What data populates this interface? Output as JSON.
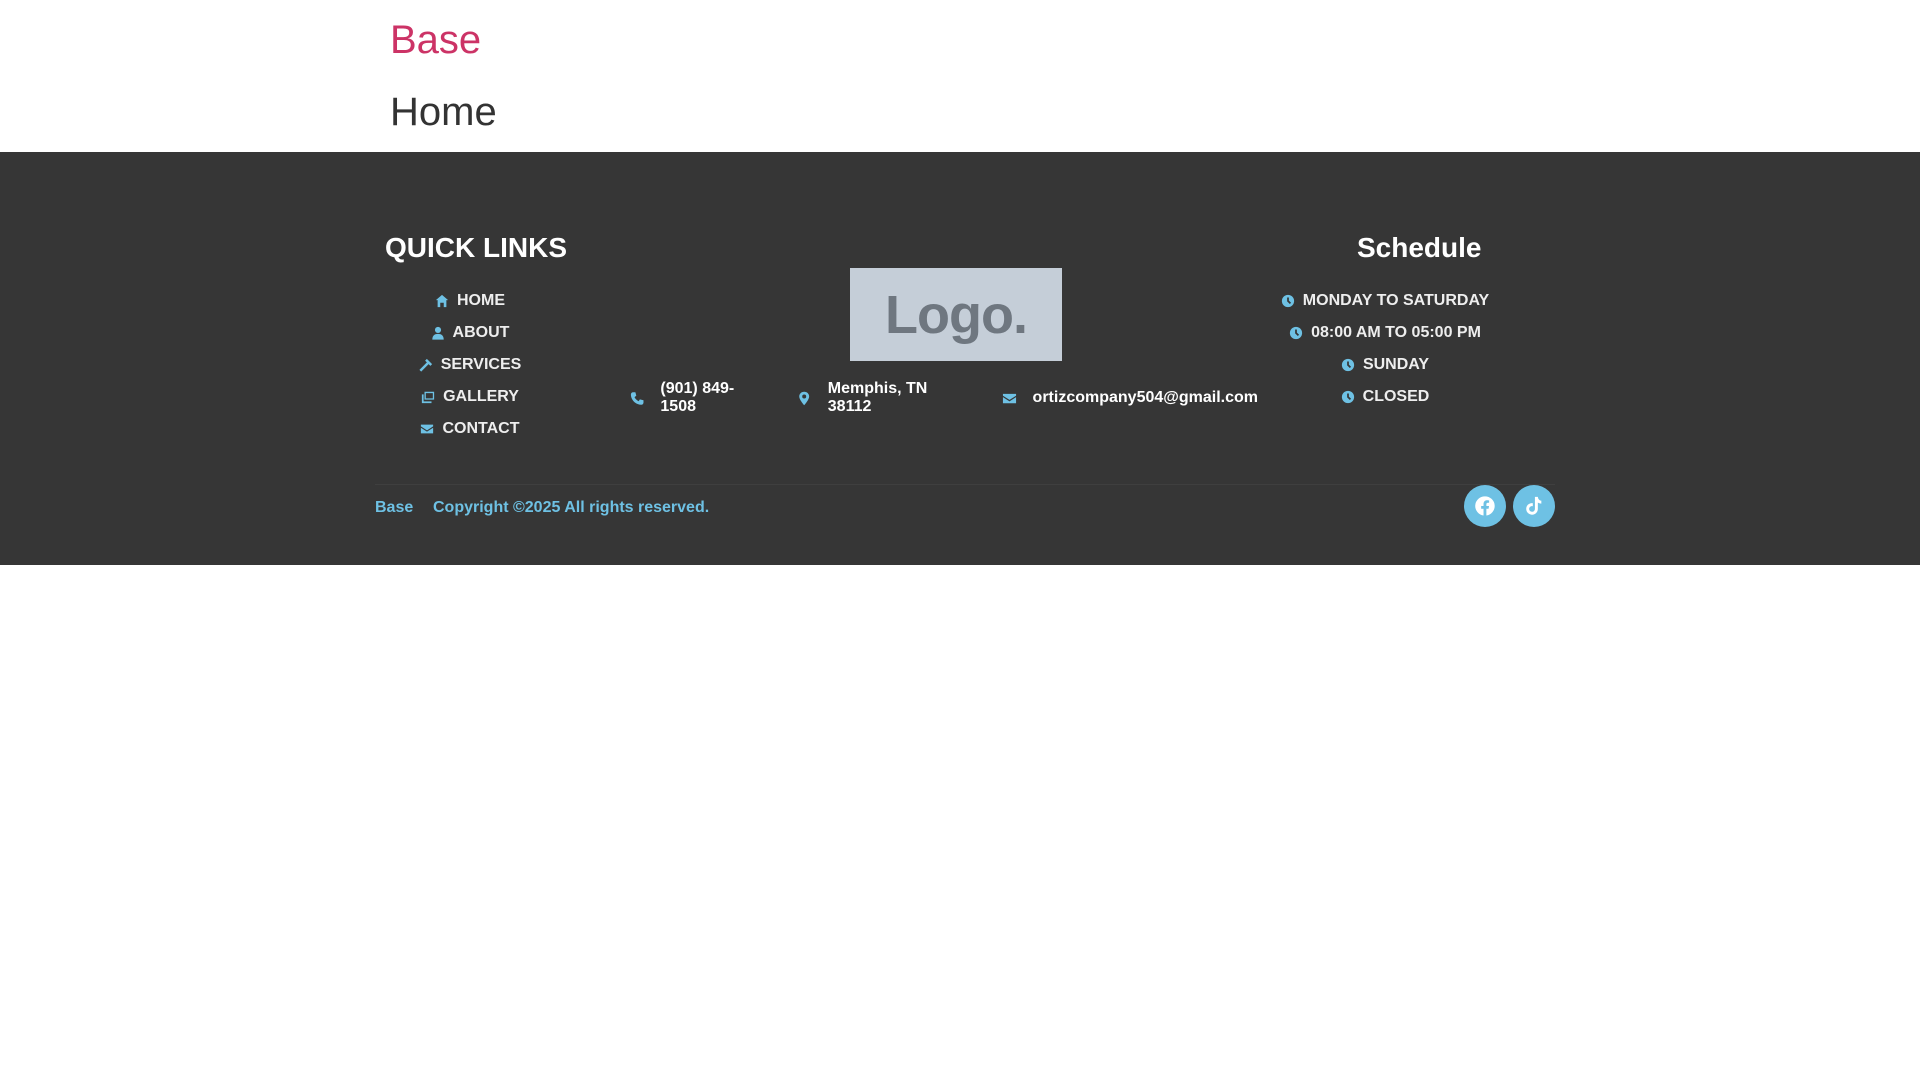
{
  "header": {
    "site_title": "Base",
    "page_title": "Home"
  },
  "footer": {
    "quick_links": {
      "title": "QUICK LINKS",
      "items": [
        {
          "label": "HOME",
          "icon": "home-icon"
        },
        {
          "label": "ABOUT",
          "icon": "user-icon"
        },
        {
          "label": "SERVICES",
          "icon": "hammer-icon"
        },
        {
          "label": "GALLERY",
          "icon": "images-icon"
        },
        {
          "label": "CONTACT",
          "icon": "envelope-icon"
        }
      ]
    },
    "logo_text": "Logo.",
    "contact": {
      "phone": "(901) 849-1508",
      "address": "Memphis, TN 38112",
      "email": "ortizcompany504@gmail.com"
    },
    "schedule": {
      "title": "Schedule",
      "items": [
        {
          "label": "MONDAY TO SATURDAY",
          "icon": "clock-icon"
        },
        {
          "label": "08:00 AM TO 05:00 PM",
          "icon": "clock-icon"
        },
        {
          "label": "SUNDAY",
          "icon": "clock-icon"
        },
        {
          "label": "CLOSED",
          "icon": "clock-icon"
        }
      ]
    },
    "bottom": {
      "brand": "Base",
      "copyright": "Copyright ©2025 All rights reserved."
    },
    "social": [
      {
        "name": "facebook",
        "icon": "facebook-icon"
      },
      {
        "name": "tiktok",
        "icon": "tiktok-icon"
      }
    ]
  },
  "colors": {
    "accent": "#6ec1e4",
    "brand": "#cc3366",
    "footer_bg": "#363636"
  }
}
